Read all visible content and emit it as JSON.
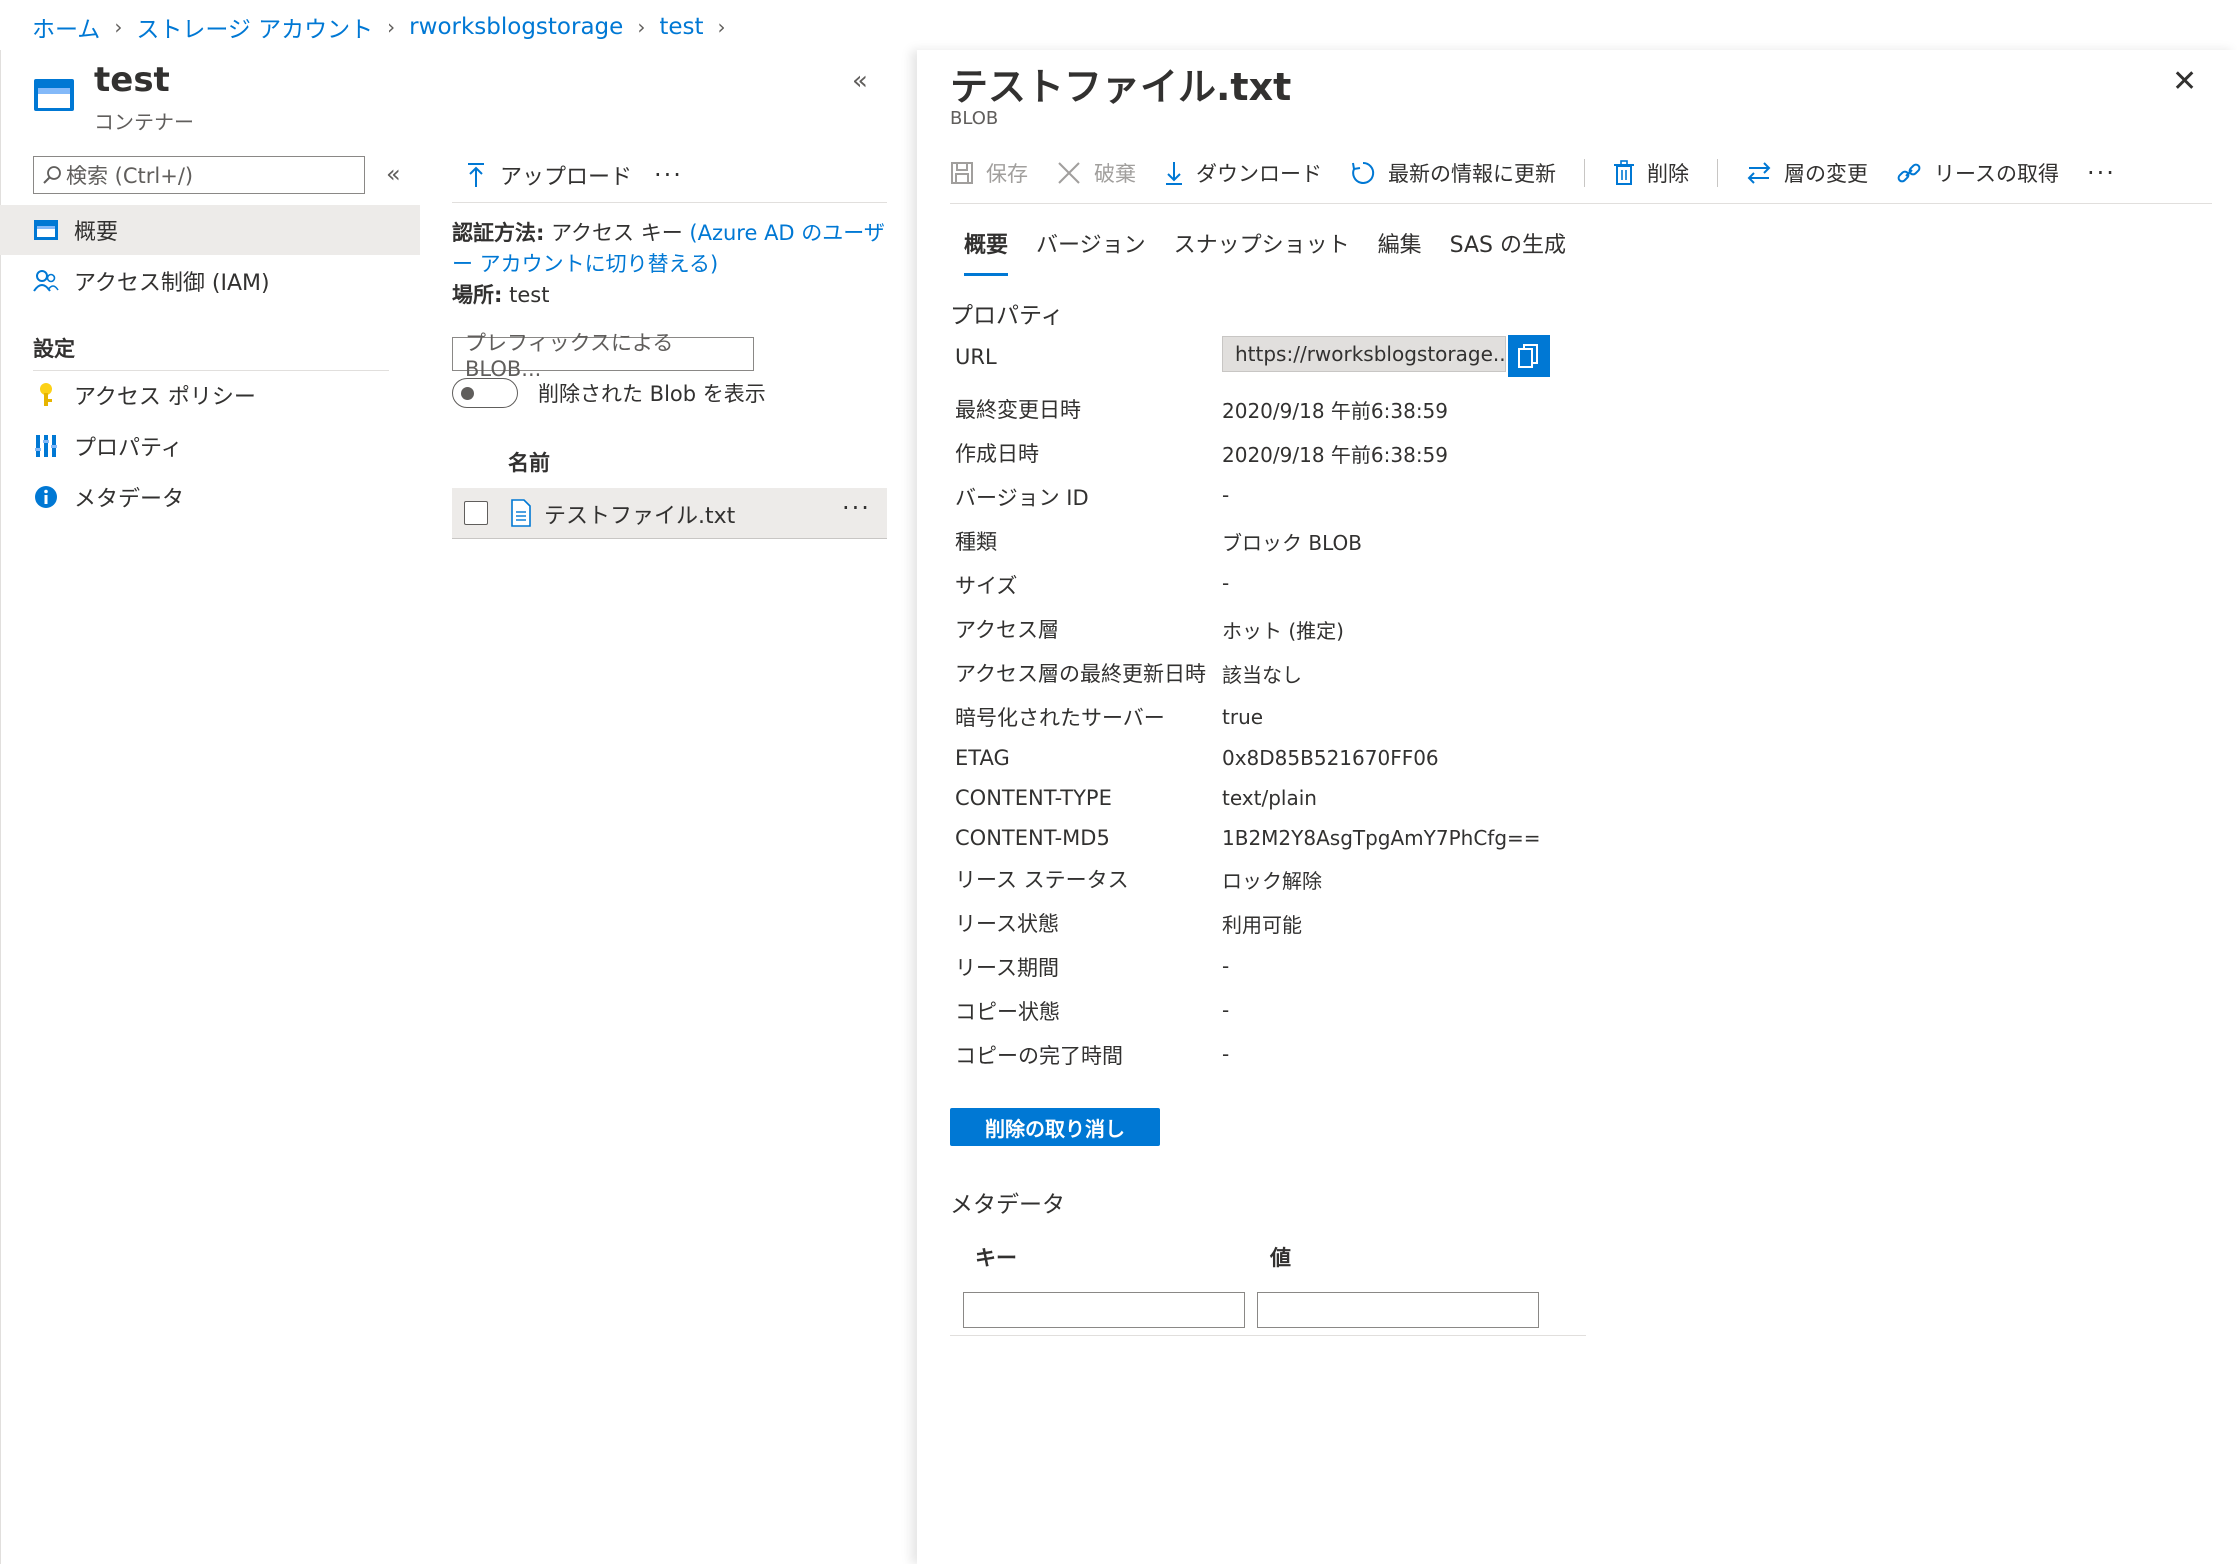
{
  "breadcrumb": [
    "ホーム",
    "ストレージ アカウント",
    "rworksblogstorage",
    "test"
  ],
  "left": {
    "title": "test",
    "subtitle": "コンテナー",
    "collapse_glyph": "«",
    "search_placeholder": "検索 (Ctrl+/)",
    "nav_collapse_glyph": "«",
    "nav_items": [
      {
        "label": "概要",
        "icon": "container-icon",
        "selected": true
      },
      {
        "label": "アクセス制御 (IAM)",
        "icon": "people-icon",
        "selected": false
      }
    ],
    "settings_heading": "設定",
    "settings_items": [
      {
        "label": "アクセス ポリシー",
        "icon": "key-icon"
      },
      {
        "label": "プロパティ",
        "icon": "properties-icon"
      },
      {
        "label": "メタデータ",
        "icon": "info-icon"
      }
    ]
  },
  "middle": {
    "upload_label": "アップロード",
    "more_glyph": "···",
    "auth_label": "認証方法:",
    "auth_value": "アクセス キー",
    "auth_link": "(Azure AD のユーザー アカウントに切り替える)",
    "location_label": "場所:",
    "location_value": "test",
    "prefix_placeholder": "プレフィックスによる BLOB...",
    "toggle_label": "削除された Blob を表示",
    "column_header": "名前",
    "files": [
      {
        "name": "テストファイル.txt"
      }
    ]
  },
  "right": {
    "title": "テストファイル.txt",
    "subtitle": "BLOB",
    "close_glyph": "✕",
    "toolbar": {
      "save": "保存",
      "discard": "破棄",
      "download": "ダウンロード",
      "refresh": "最新の情報に更新",
      "delete": "削除",
      "change_tier": "層の変更",
      "acquire_lease": "リースの取得",
      "more": "···"
    },
    "tabs": [
      "概要",
      "バージョン",
      "スナップショット",
      "編集",
      "SAS の生成"
    ],
    "active_tab": "概要",
    "properties_title": "プロパティ",
    "url_label": "URL",
    "url_value": "https://rworksblogstorage....",
    "properties": [
      {
        "label": "最終変更日時",
        "value": "2020/9/18 午前6:38:59"
      },
      {
        "label": "作成日時",
        "value": "2020/9/18 午前6:38:59"
      },
      {
        "label": "バージョン ID",
        "value": "-"
      },
      {
        "label": "種類",
        "value": "ブロック BLOB"
      },
      {
        "label": "サイズ",
        "value": "-"
      },
      {
        "label": "アクセス層",
        "value": "ホット (推定)"
      },
      {
        "label": "アクセス層の最終更新日時",
        "value": "該当なし"
      },
      {
        "label": "暗号化されたサーバー",
        "value": "true"
      },
      {
        "label": "ETAG",
        "value": "0x8D85B521670FF06"
      },
      {
        "label": "CONTENT-TYPE",
        "value": "text/plain"
      },
      {
        "label": "CONTENT-MD5",
        "value": "1B2M2Y8AsgTpgAmY7PhCfg=="
      },
      {
        "label": "リース ステータス",
        "value": "ロック解除"
      },
      {
        "label": "リース状態",
        "value": "利用可能"
      },
      {
        "label": "リース期間",
        "value": "-"
      },
      {
        "label": "コピー状態",
        "value": "-"
      },
      {
        "label": "コピーの完了時間",
        "value": "-"
      }
    ],
    "undelete_button": "削除の取り消し",
    "metadata_title": "メタデータ",
    "metadata_key_header": "キー",
    "metadata_value_header": "値"
  },
  "colors": {
    "accent": "#0078d4",
    "selected_bg": "#edebe9",
    "text": "#323130",
    "muted": "#605e5c"
  }
}
